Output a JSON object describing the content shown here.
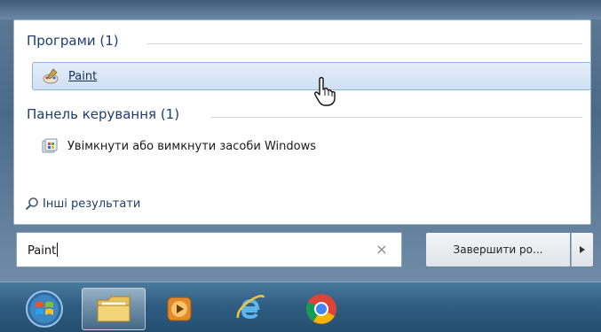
{
  "start_menu": {
    "programs_header": "Програми (1)",
    "programs": [
      {
        "label": "Paint",
        "icon": "paint-icon",
        "selected": true
      }
    ],
    "control_panel_header": "Панель керування (1)",
    "control_panel_items": [
      {
        "label": "Увімкнути або вимкнути засоби Windows",
        "icon": "windows-features-icon"
      }
    ],
    "more_results": "Інші результати"
  },
  "search": {
    "value": "Paint",
    "clear_glyph": "×"
  },
  "shutdown": {
    "label": "Завершити ро..."
  },
  "taskbar": {
    "items": [
      {
        "name": "start-orb",
        "icon": "windows-logo-icon"
      },
      {
        "name": "windows-explorer",
        "icon": "folder-icon",
        "active": true
      },
      {
        "name": "media-player",
        "icon": "media-player-icon"
      },
      {
        "name": "internet-explorer",
        "icon": "internet-explorer-icon"
      },
      {
        "name": "chrome",
        "icon": "chrome-icon"
      }
    ]
  },
  "colors": {
    "taskbar": "#2f5e82",
    "selection": "#cfe0f3",
    "section_title": "#1f3d6f"
  }
}
